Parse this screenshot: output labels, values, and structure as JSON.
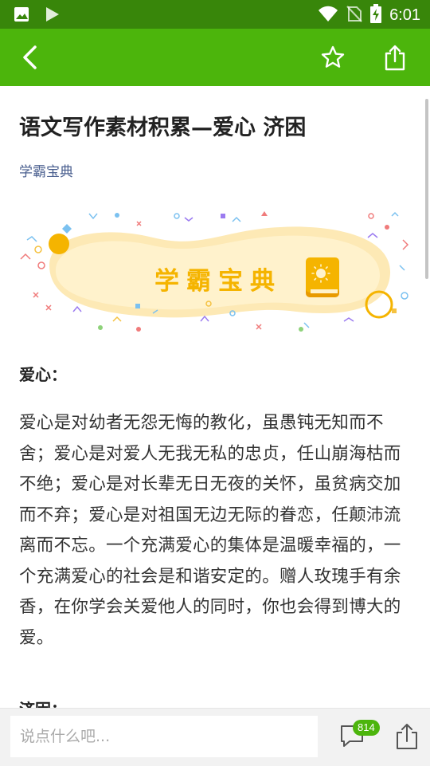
{
  "status_bar": {
    "time": "6:01",
    "icons": [
      "image-icon",
      "play-icon",
      "wifi-icon",
      "no-sim-icon",
      "battery-charging-icon"
    ]
  },
  "toolbar": {
    "icons": [
      "back-arrow-icon",
      "star-icon",
      "share-icon"
    ]
  },
  "article": {
    "title": "语文写作素材积累—爱心 济困",
    "author": "学霸宝典",
    "banner_text": "学霸宝典",
    "section1_heading": "爱心：",
    "section1_body": "爱心是对幼者无怨无悔的教化，虽愚钝无知而不舍；爱心是对爱人无我无私的忠贞，任山崩海枯而不绝；爱心是对长辈无日无夜的关怀，虽贫病交加而不弃；爱心是对祖国无边无际的眷恋，任颠沛流离而不忘。一个充满爱心的集体是温暖幸福的，一个充满爱心的社会是和谐安定的。赠人玫瑰手有余香，在你学会关爱他人的同时，你也会得到博大的爱。",
    "section2_heading": "济困："
  },
  "bottom_bar": {
    "comment_placeholder": "说点什么吧...",
    "comment_count": "814"
  },
  "colors": {
    "status_bar": "#38860a",
    "toolbar": "#4cb50c",
    "author_link": "#4a5f8f",
    "banner_accent": "#f5b400"
  }
}
